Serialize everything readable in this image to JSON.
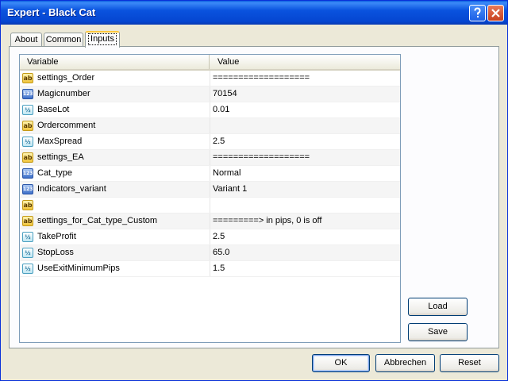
{
  "window": {
    "title": "Expert - Black Cat",
    "help_icon": "question-icon",
    "close_icon": "close-icon"
  },
  "tabs": [
    {
      "label": "About",
      "active": false
    },
    {
      "label": "Common",
      "active": false
    },
    {
      "label": "Inputs",
      "active": true
    }
  ],
  "table": {
    "columns": [
      "Variable",
      "Value"
    ],
    "rows": [
      {
        "type": "ab",
        "icon_text": "ab",
        "name": "settings_Order",
        "value": "==================="
      },
      {
        "type": "n123",
        "icon_text": "123",
        "name": "Magicnumber",
        "value": "70154"
      },
      {
        "type": "v12",
        "icon_text": "½",
        "name": "BaseLot",
        "value": "0.01"
      },
      {
        "type": "ab",
        "icon_text": "ab",
        "name": "Ordercomment",
        "value": ""
      },
      {
        "type": "v12",
        "icon_text": "½",
        "name": "MaxSpread",
        "value": "2.5"
      },
      {
        "type": "ab",
        "icon_text": "ab",
        "name": "settings_EA",
        "value": "==================="
      },
      {
        "type": "n123",
        "icon_text": "123",
        "name": "Cat_type",
        "value": "Normal"
      },
      {
        "type": "n123",
        "icon_text": "123",
        "name": "Indicators_variant",
        "value": "Variant 1"
      },
      {
        "type": "ab",
        "icon_text": "ab",
        "name": "",
        "value": ""
      },
      {
        "type": "ab",
        "icon_text": "ab",
        "name": "settings_for_Cat_type_Custom",
        "value": "=========> in pips, 0 is off"
      },
      {
        "type": "v12",
        "icon_text": "½",
        "name": "TakeProfit",
        "value": "2.5"
      },
      {
        "type": "v12",
        "icon_text": "½",
        "name": "StopLoss",
        "value": "65.0"
      },
      {
        "type": "v12",
        "icon_text": "½",
        "name": "UseExitMinimumPips",
        "value": "1.5"
      }
    ]
  },
  "side_buttons": {
    "load": "Load",
    "save": "Save"
  },
  "footer_buttons": {
    "ok": "OK",
    "cancel": "Abbrechen",
    "reset": "Reset"
  }
}
